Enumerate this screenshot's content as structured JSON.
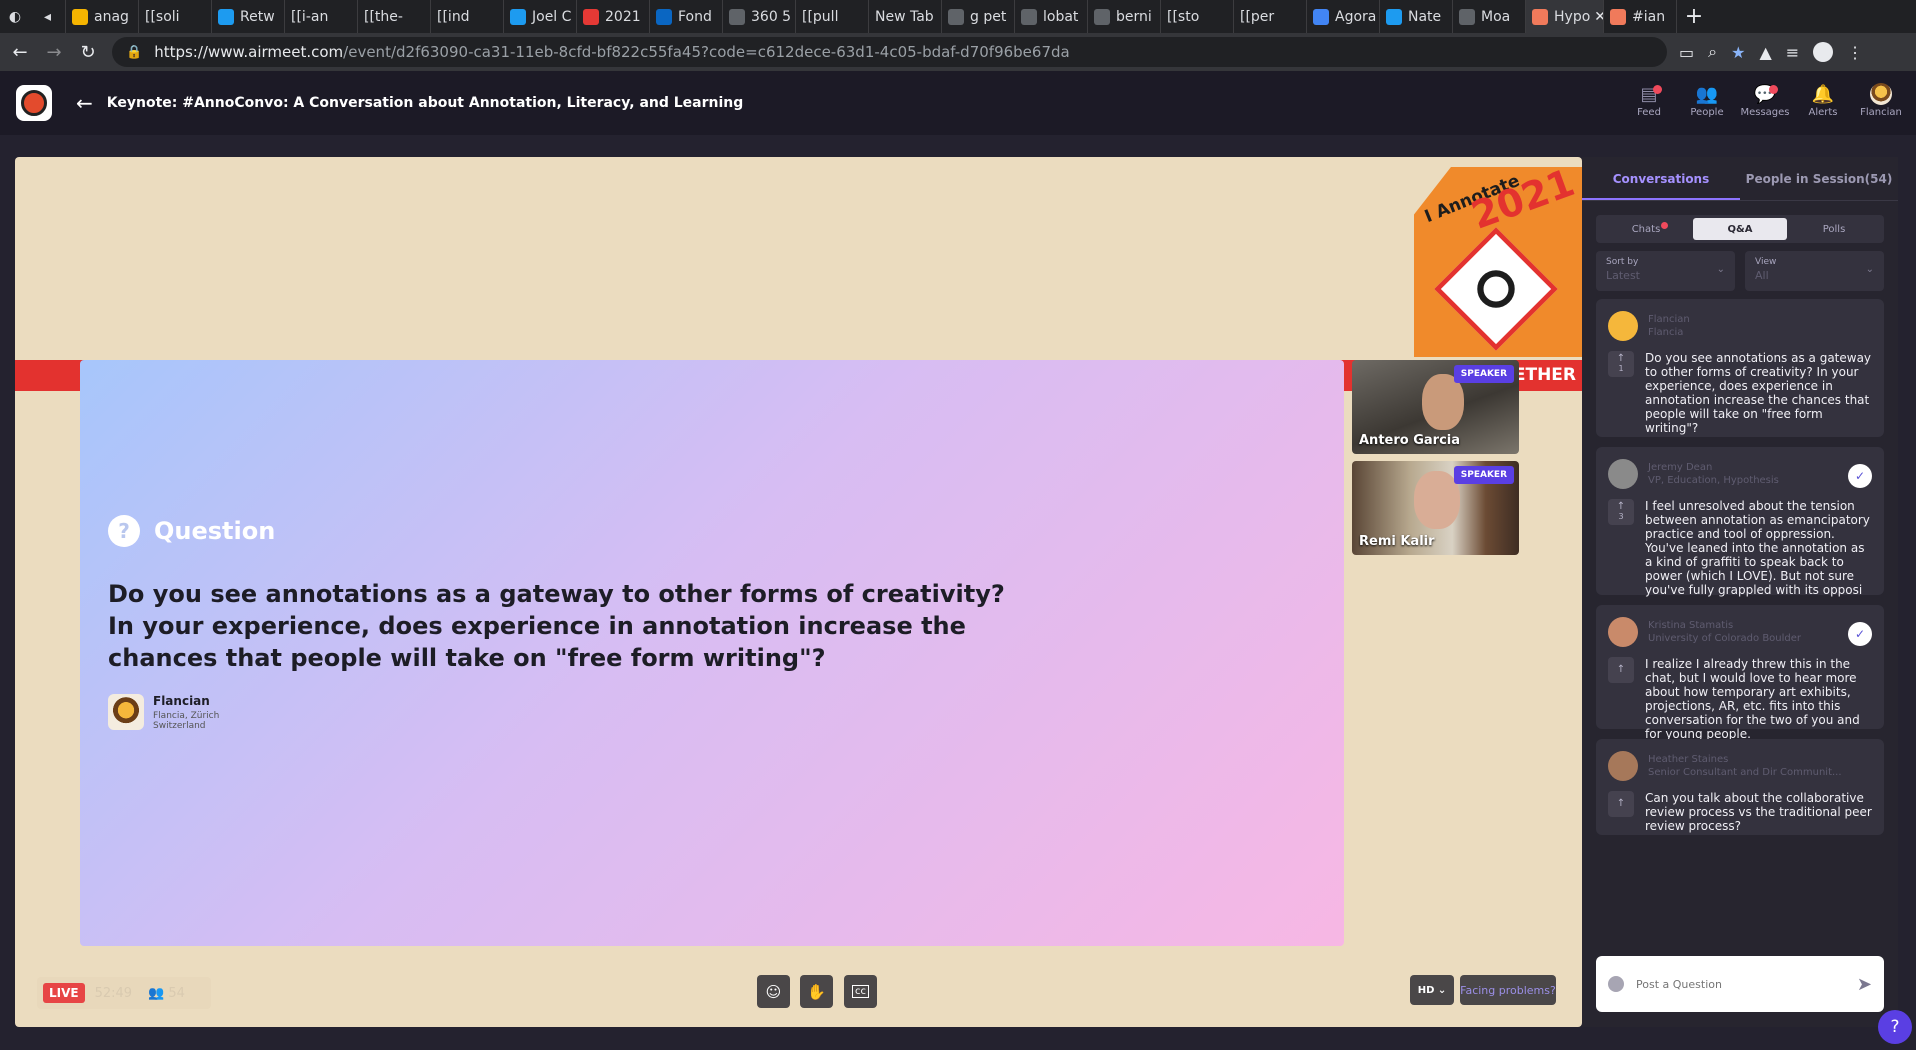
{
  "browser": {
    "tabs": [
      {
        "label": "anag",
        "fav": "#f5b400"
      },
      {
        "label": "[[soli",
        "fav": ""
      },
      {
        "label": "Retw",
        "fav": "#1d9bf0"
      },
      {
        "label": "[[i-an",
        "fav": ""
      },
      {
        "label": "[[the-",
        "fav": ""
      },
      {
        "label": "[[ind",
        "fav": ""
      },
      {
        "label": "Joel C",
        "fav": "#1d9bf0"
      },
      {
        "label": "2021",
        "fav": "#e53935"
      },
      {
        "label": "Fond",
        "fav": "#0a66c2"
      },
      {
        "label": "360 5",
        "fav": "#5f6368"
      },
      {
        "label": "[[pull",
        "fav": ""
      },
      {
        "label": "New Tab",
        "fav": ""
      },
      {
        "label": "g pet",
        "fav": "#5f6368"
      },
      {
        "label": "lobat",
        "fav": "#5f6368"
      },
      {
        "label": "berni",
        "fav": "#5f6368"
      },
      {
        "label": "[[sto",
        "fav": ""
      },
      {
        "label": "[[per",
        "fav": ""
      },
      {
        "label": "Agora",
        "fav": "#4285f4"
      },
      {
        "label": "Nate",
        "fav": "#1d9bf0"
      },
      {
        "label": "Moa",
        "fav": "#5f6368"
      },
      {
        "label": "Hypo",
        "fav": "#f07a5b"
      },
      {
        "label": "#ian",
        "fav": "#f07a5b"
      }
    ],
    "url_host": "https://www.airmeet.com",
    "url_path": "/event/d2f63090-ca31-11eb-8cfd-bf822c55fa45?code=c612dece-63d1-4c05-bdaf-d70f96be67da"
  },
  "header": {
    "event_title": "Keynote: #AnnoConvo: A Conversation about Annotation, Literacy, and Learning",
    "nav": [
      "Feed",
      "People",
      "Messages",
      "Alerts",
      "Flancian"
    ]
  },
  "stage": {
    "badge_text": "I Annotate",
    "badge_year": "2021",
    "band_text": "GETHER",
    "question_label": "Question",
    "question_text": "Do you see annotations as a gateway to other forms of creativity? In your experience, does experience in annotation increase the chances that people will take on \"free form writing\"?",
    "author_name": "Flancian",
    "author_location": "Flancia, Zürich Switzerland",
    "speakers": [
      {
        "name": "Antero Garcia",
        "tag": "SPEAKER"
      },
      {
        "name": "Remi Kalir",
        "tag": "SPEAKER"
      }
    ],
    "live_label": "LIVE",
    "elapsed": "52:49",
    "viewer_count": "54",
    "quality": "HD",
    "facing_problems": "Facing problems?"
  },
  "panel": {
    "tabs": [
      "Conversations",
      "People in Session(54)"
    ],
    "segments": [
      "Chats",
      "Q&A",
      "Polls"
    ],
    "sort_label": "Sort by",
    "sort_value": "Latest",
    "view_label": "View",
    "view_value": "All",
    "questions": [
      {
        "name": "Flancian",
        "sub": "Flancia",
        "votes": "1",
        "answered": false,
        "avatar": "#f5b73b",
        "text": "Do you see annotations as a gateway to other forms of creativity? In your experience, does experience in annotation increase the chances that people will take on \"free form writing\"?"
      },
      {
        "name": "Jeremy Dean",
        "sub": "VP, Education, Hypothesis",
        "votes": "3",
        "answered": true,
        "avatar": "#8a8a8a",
        "text": "I feel unresolved about the tension between annotation as emancipatory practice and tool of oppression. You've leaned into the annotation as a kind of graffiti to speak back to power (which I LOVE). But not sure you've fully grappled with its opposi"
      },
      {
        "name": "Kristina Stamatis",
        "sub": "University of Colorado Boulder",
        "votes": "",
        "answered": true,
        "avatar": "#c98a6a",
        "text": "I realize I already threw this in the chat, but I would love to hear more about how temporary art exhibits, projections, AR, etc. fits into this conversation for the two of you and for young people."
      },
      {
        "name": "Heather Staines",
        "sub": "Senior Consultant and Dir Communit...",
        "votes": "",
        "answered": false,
        "avatar": "#a6785a",
        "text": "Can you talk about the collaborative review process vs the traditional peer review process?"
      }
    ],
    "post_placeholder": "Post a Question"
  }
}
